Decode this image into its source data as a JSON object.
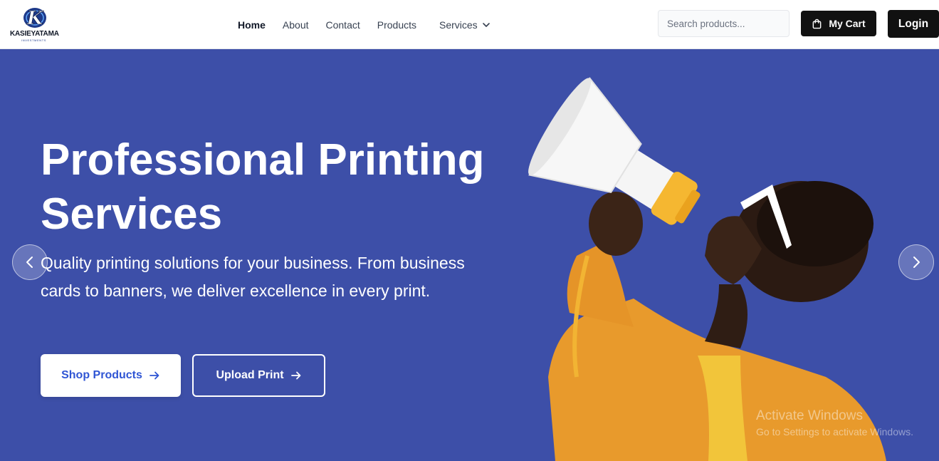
{
  "brand": {
    "name": "KASIEYATAMA",
    "sub": "INVESTMENTS",
    "logo_letter": "K"
  },
  "nav": {
    "links": [
      "Home",
      "About",
      "Contact",
      "Products"
    ],
    "services_label": "Services",
    "active": "Home"
  },
  "search": {
    "placeholder": "Search products..."
  },
  "header_actions": {
    "cart_label": "My Cart",
    "login_label": "Login"
  },
  "hero": {
    "title": "Professional Printing Services",
    "subtitle": "Quality printing solutions for your business. From business cards to banners, we deliver excellence in every print.",
    "primary_button": "Shop Products",
    "secondary_button": "Upload Print",
    "background_color": "#3d4fa8"
  },
  "watermark": {
    "title": "Activate Windows",
    "subtitle": "Go to Settings to activate Windows."
  },
  "icons": {
    "cart": "shopping-bag-icon",
    "services": "chevron-down-icon",
    "button_arrow": "arrow-right-icon",
    "carousel_prev": "chevron-left-icon",
    "carousel_next": "chevron-right-icon"
  },
  "colors": {
    "primary_text": "#2f55d4",
    "dark_button": "#111111"
  }
}
